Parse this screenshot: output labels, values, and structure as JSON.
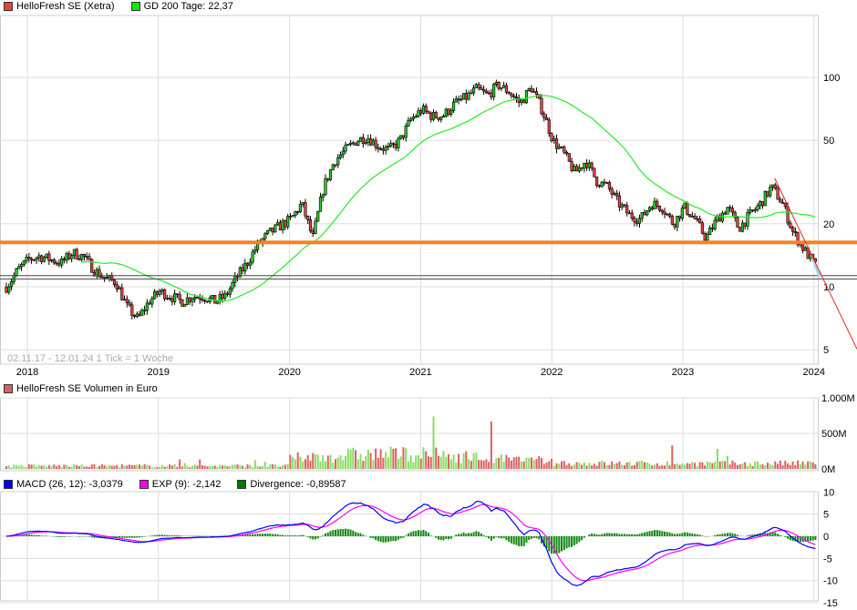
{
  "legend_main": {
    "price": "HelloFresh SE (Xetra)",
    "price_color": "#e84040",
    "gd": "GD 200 Tage: 22,37",
    "gd_color": "#00ee00"
  },
  "legend_volume": {
    "label": "HelloFresh SE Volumen in Euro",
    "color": "#d96060"
  },
  "legend_macd": {
    "macd": "MACD (26, 12): -3,0379",
    "macd_color": "#0000ff",
    "exp": "EXP (9): -2,142",
    "exp_color": "#ff00ff",
    "div": "Divergence: -0,89587",
    "div_color": "#007700"
  },
  "range_note": "02.11.17 - 12.01.24   1 Tick = 1 Woche",
  "chart_data": {
    "type": "candlestick",
    "scale": "log",
    "x_ticks": [
      "2018",
      "2019",
      "2020",
      "2021",
      "2022",
      "2023",
      "2024"
    ],
    "y_ticks": [
      "100",
      "50",
      "20",
      "10",
      "5"
    ],
    "y_tick_values": [
      100,
      50,
      20,
      10,
      5
    ],
    "monthly_close": {
      "start": "2017-11",
      "values": [
        10,
        12,
        13.5,
        14,
        13.5,
        13,
        14.5,
        14,
        12,
        11,
        10.5,
        8,
        7,
        8.5,
        9.5,
        9,
        8.5,
        9,
        9,
        8.5,
        9,
        11,
        13,
        16,
        18,
        19.5,
        21,
        25,
        17,
        30,
        40,
        45,
        50,
        52,
        47,
        45,
        50,
        63,
        70,
        65,
        66,
        75,
        80,
        88,
        82,
        92,
        85,
        75,
        90,
        70,
        50,
        43,
        35,
        40,
        32,
        30,
        25,
        22,
        21,
        25,
        24,
        20,
        24,
        21,
        17,
        21,
        24,
        19,
        22,
        25,
        30,
        25,
        18,
        15,
        12.6
      ]
    },
    "support_line": 16.3,
    "red_lines": [
      11.3,
      10.9
    ],
    "trendline": {
      "from": [
        "2023-09",
        33
      ],
      "to": [
        "2024-01",
        12
      ]
    },
    "volume": {
      "y_ticks": [
        "1.000M",
        "500M",
        "0M"
      ],
      "y_tick_values": [
        1000,
        500,
        0
      ],
      "unit": "M EUR"
    },
    "macd": {
      "y_ticks": [
        "10",
        "5",
        "0",
        "-5",
        "-10",
        "-15"
      ],
      "y_tick_values": [
        10,
        5,
        0,
        -5,
        -10,
        -15
      ]
    }
  }
}
